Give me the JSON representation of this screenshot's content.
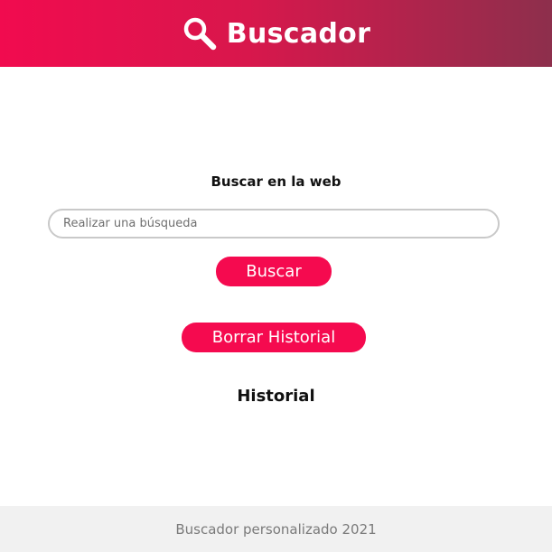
{
  "header": {
    "title": "Buscador",
    "icon": "magnifying-glass-icon",
    "gradient_colors": [
      "#f10b4f",
      "#d8174c",
      "#8d2f4c"
    ]
  },
  "search": {
    "heading": "Buscar en la web",
    "placeholder": "Realizar una búsqueda",
    "value": "",
    "button_label": "Buscar"
  },
  "history": {
    "clear_button_label": "Borrar Historial",
    "heading": "Historial",
    "items": []
  },
  "footer": {
    "text": "Buscador personalizado 2021"
  },
  "colors": {
    "accent": "#f50a4f",
    "footer_bg": "#f1f1f1",
    "footer_text": "#7a7a7a"
  }
}
